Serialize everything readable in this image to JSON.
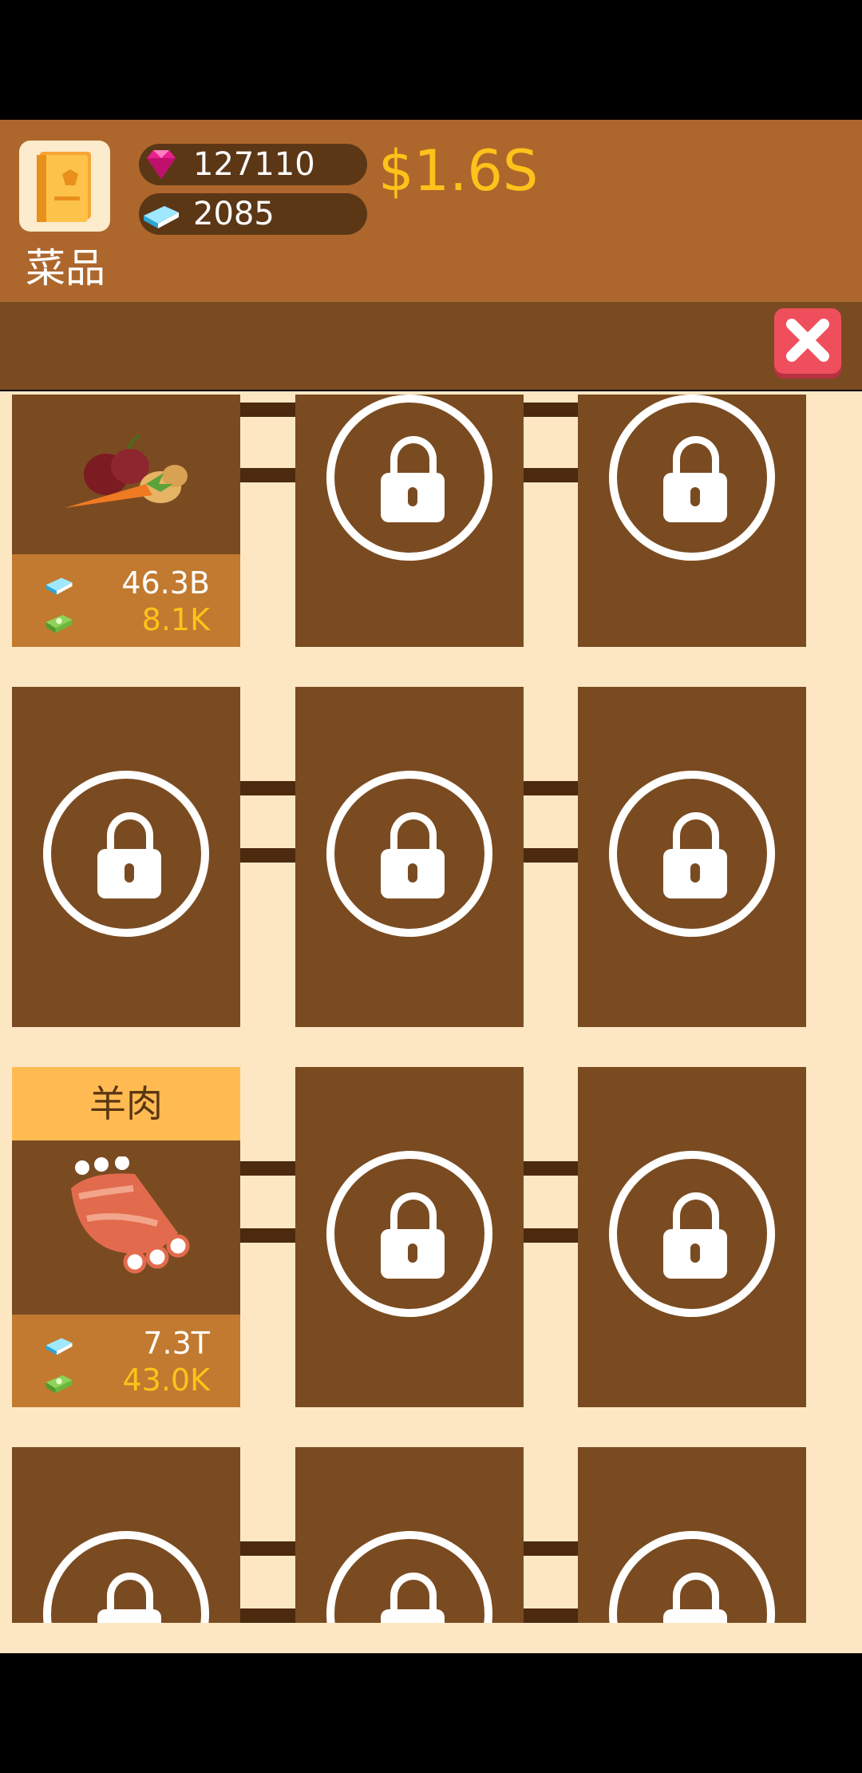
{
  "header": {
    "book_label": "菜品",
    "gems": "127110",
    "books": "2085",
    "money": "$1.6S"
  },
  "items": [
    {
      "name": "",
      "book_value": "46.3B",
      "money_value": "8.1K",
      "icon": "vegetables-icon"
    },
    {
      "name": "羊肉",
      "book_value": "7.3T",
      "money_value": "43.0K",
      "icon": "lamb-ribs-icon"
    }
  ],
  "icons": {
    "gem": "gem-icon",
    "book": "book-icon",
    "cash": "cash-icon",
    "lock": "lock-icon",
    "close": "close-icon"
  },
  "colors": {
    "header": "#ad672c",
    "tile": "#7a4b21",
    "background": "#fde7c3",
    "accent_gold": "#ffc21a",
    "close_red": "#ef4f5c",
    "title_bar": "#ffbb52"
  }
}
